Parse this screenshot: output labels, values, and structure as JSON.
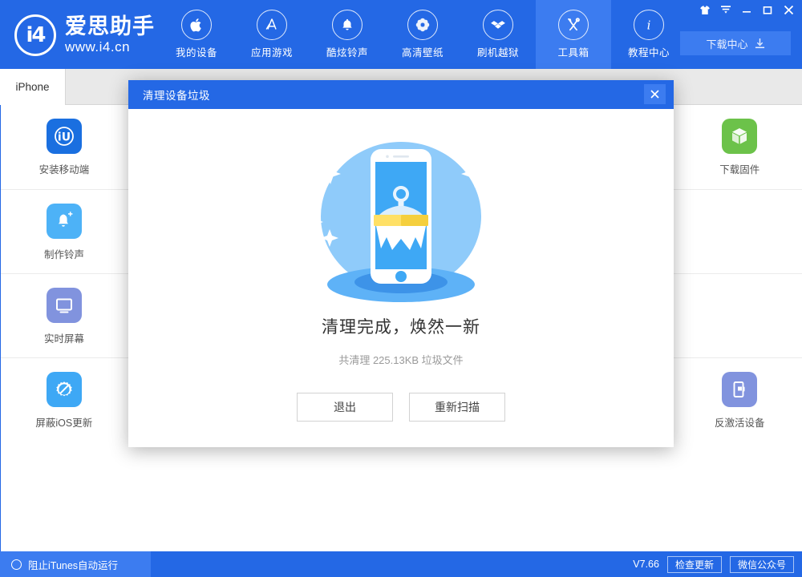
{
  "header": {
    "logo": {
      "mark": "i4",
      "name": "爱思助手",
      "url": "www.i4.cn"
    },
    "nav": [
      {
        "label": "我的设备",
        "icon": "apple-icon",
        "active": false
      },
      {
        "label": "应用游戏",
        "icon": "appstore-icon",
        "active": false
      },
      {
        "label": "酷炫铃声",
        "icon": "bell-icon",
        "active": false
      },
      {
        "label": "高清壁纸",
        "icon": "flower-icon",
        "active": false
      },
      {
        "label": "刷机越狱",
        "icon": "box-open-icon",
        "active": false
      },
      {
        "label": "工具箱",
        "icon": "tools-icon",
        "active": true
      },
      {
        "label": "教程中心",
        "icon": "info-icon",
        "active": false
      }
    ],
    "window_controls": [
      {
        "name": "skin-icon",
        "title": "换肤"
      },
      {
        "name": "menu-icon",
        "title": "菜单"
      },
      {
        "name": "minimize-icon",
        "title": "最小化"
      },
      {
        "name": "maximize-icon",
        "title": "最大化"
      },
      {
        "name": "close-icon",
        "title": "关闭"
      }
    ],
    "download_center": "下载中心"
  },
  "tabs": [
    {
      "label": "iPhone",
      "active": true
    }
  ],
  "tool_grid": {
    "rows": [
      [
        {
          "label": "安装移动端",
          "icon": "i4-app-icon",
          "color": "#1a6fe0",
          "empty": false
        },
        {
          "label": "",
          "icon": "",
          "color": "",
          "empty": true
        },
        {
          "label": "",
          "icon": "",
          "color": "",
          "empty": true
        },
        {
          "label": "",
          "icon": "",
          "color": "",
          "empty": true
        },
        {
          "label": "",
          "icon": "",
          "color": "",
          "empty": true
        },
        {
          "label": "下载固件",
          "icon": "cube-icon",
          "color": "#6cc24a",
          "empty": false
        }
      ],
      [
        {
          "label": "制作铃声",
          "icon": "bell-plus-icon",
          "color": "#4db2f7",
          "empty": false
        },
        {
          "label": "",
          "icon": "",
          "color": "",
          "empty": true
        },
        {
          "label": "",
          "icon": "",
          "color": "",
          "empty": true
        },
        {
          "label": "",
          "icon": "",
          "color": "",
          "empty": true
        },
        {
          "label": "",
          "icon": "",
          "color": "",
          "empty": true
        },
        {
          "label": "",
          "icon": "",
          "color": "",
          "empty": true
        }
      ],
      [
        {
          "label": "实时屏幕",
          "icon": "monitor-icon",
          "color": "#8193de",
          "empty": false
        },
        {
          "label": "",
          "icon": "",
          "color": "",
          "empty": true
        },
        {
          "label": "",
          "icon": "",
          "color": "",
          "empty": true
        },
        {
          "label": "",
          "icon": "",
          "color": "",
          "empty": true
        },
        {
          "label": "",
          "icon": "",
          "color": "",
          "empty": true
        },
        {
          "label": "",
          "icon": "",
          "color": "",
          "empty": true
        }
      ],
      [
        {
          "label": "屏蔽iOS更新",
          "icon": "gear-block-icon",
          "color": "#3ea8f5",
          "empty": false
        },
        {
          "label": "",
          "icon": "",
          "color": "",
          "empty": true
        },
        {
          "label": "",
          "icon": "",
          "color": "",
          "empty": true
        },
        {
          "label": "",
          "icon": "",
          "color": "",
          "empty": true
        },
        {
          "label": "",
          "icon": "",
          "color": "",
          "empty": true
        },
        {
          "label": "反激活设备",
          "icon": "device-deactivate-icon",
          "color": "#8193de",
          "empty": false
        }
      ]
    ]
  },
  "modal": {
    "title": "清理设备垃圾",
    "close_icon": "close-icon",
    "illustration": "phone-broom-clean-illustration",
    "result_title": "清理完成，焕然一新",
    "result_subtitle": "共清理 225.13KB 垃圾文件",
    "buttons": [
      {
        "label": "退出",
        "name": "exit-button"
      },
      {
        "label": "重新扫描",
        "name": "rescan-button"
      }
    ]
  },
  "footer": {
    "itunes_toggle": "阻止iTunes自动运行",
    "version": "V7.66",
    "check_update": "检查更新",
    "wechat": "微信公众号"
  },
  "colors": {
    "brand_blue": "#2468e5",
    "brand_blue_light": "#3c7cf0",
    "illus_circle": "#8fcbfa",
    "illus_screen": "#3ea8f5",
    "broom_band": "#ffe066"
  }
}
